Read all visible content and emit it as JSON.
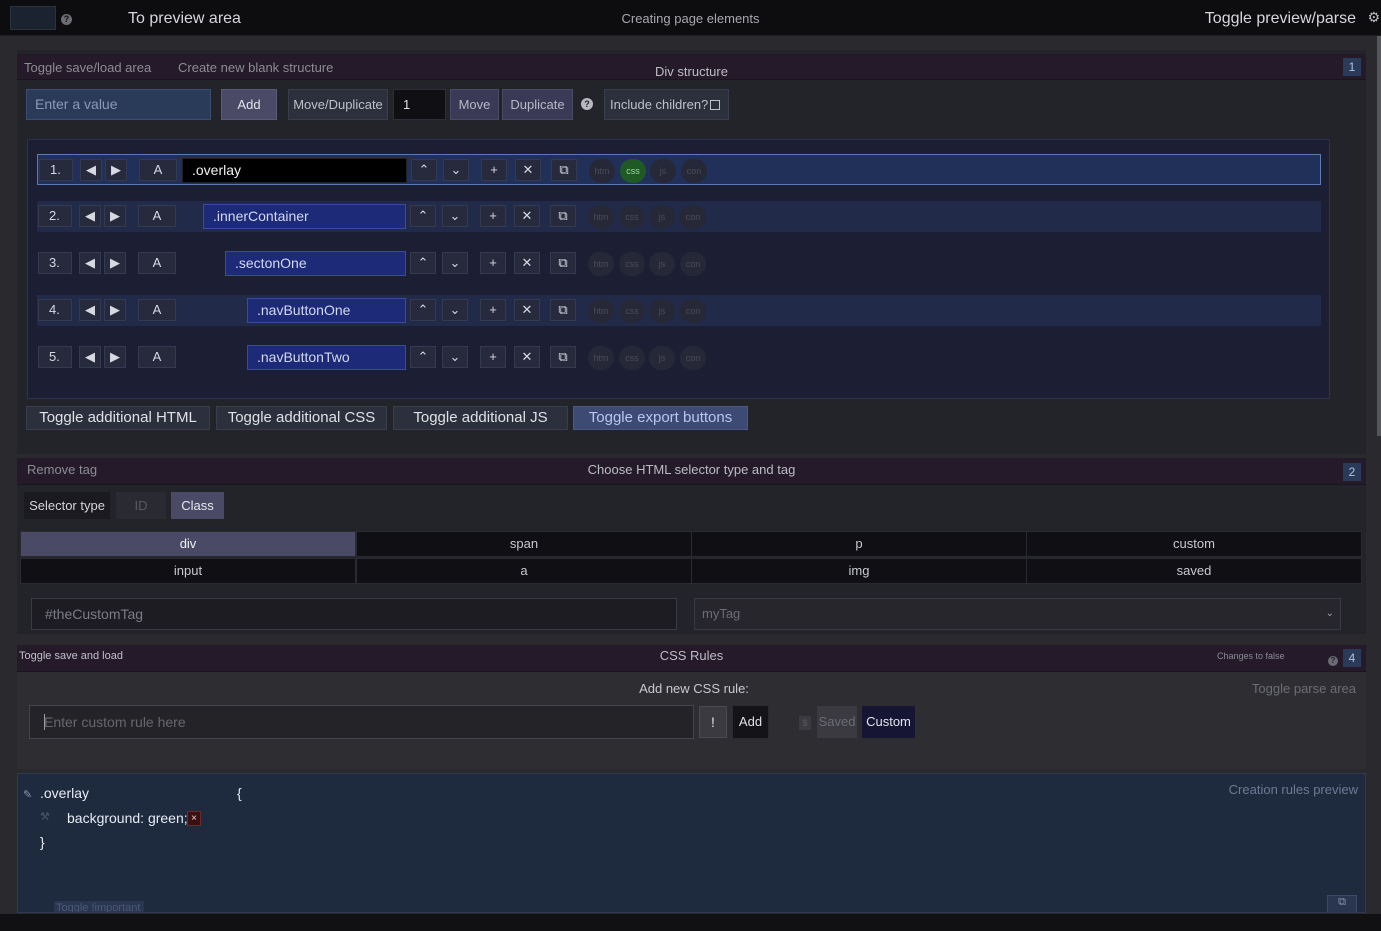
{
  "topbar": {
    "help": "?",
    "preview_link": "To preview area",
    "title": "Creating page elements",
    "toggle_preview": "Toggle preview/parse",
    "gear": "⚙"
  },
  "section1": {
    "left_links": [
      "Toggle save/load area",
      "Create new blank structure"
    ],
    "title": "Div structure",
    "number": "1",
    "input_placeholder": "Enter a value",
    "add_label": "Add",
    "move_duplicate_label": "Move/Duplicate",
    "count_value": "1",
    "move_label": "Move",
    "duplicate_label": "Duplicate",
    "help": "?",
    "include_children_label": "Include children?",
    "rows": [
      {
        "index": "1.",
        "name": ".overlay",
        "a": "A",
        "active_pill": "css"
      },
      {
        "index": "2.",
        "name": ".innerContainer",
        "a": "A",
        "active_pill": ""
      },
      {
        "index": "3.",
        "name": ".sectonOne",
        "a": "A",
        "active_pill": ""
      },
      {
        "index": "4.",
        "name": ".navButtonOne",
        "a": "A",
        "active_pill": ""
      },
      {
        "index": "5.",
        "name": ".navButtonTwo",
        "a": "A",
        "active_pill": ""
      }
    ],
    "pills": [
      "htm",
      "css",
      "js",
      "con"
    ],
    "toggles": [
      "Toggle additional HTML",
      "Toggle additional CSS",
      "Toggle additional JS",
      "Toggle export buttons"
    ]
  },
  "section2": {
    "left_link": "Remove tag",
    "title": "Choose HTML selector type and tag",
    "number": "2",
    "selector_type_label": "Selector type",
    "id_label": "ID",
    "class_label": "Class",
    "tags": [
      [
        "div",
        "span",
        "p",
        "custom"
      ],
      [
        "input",
        "a",
        "img",
        "saved"
      ]
    ],
    "selected_tag": "div",
    "custom_tag_placeholder": "#theCustomTag",
    "select_value": "myTag"
  },
  "section4": {
    "left_link": "Toggle save and load",
    "title": "CSS Rules",
    "changes_note": "Changes to false",
    "help": "?",
    "number": "4",
    "add_rule_label": "Add new CSS rule:",
    "toggle_parse": "Toggle parse area",
    "rule_placeholder": "Enter custom rule here",
    "excl": "!",
    "add_label": "Add",
    "dollar": "$",
    "saved_label": "Saved",
    "custom_label": "Custom"
  },
  "preview": {
    "label": "Creation rules preview",
    "selector": ".overlay",
    "brace_open": "{",
    "declaration": "background: green;",
    "delete": "×",
    "brace_close": "}",
    "toggle_important": "Toggle !important"
  },
  "colors": {
    "accent_blue": "#2a3b5a",
    "selected_row_border": "#5a7ab8",
    "css_pill_on": "#1f5a24",
    "class_selected": "#4a4a66"
  }
}
